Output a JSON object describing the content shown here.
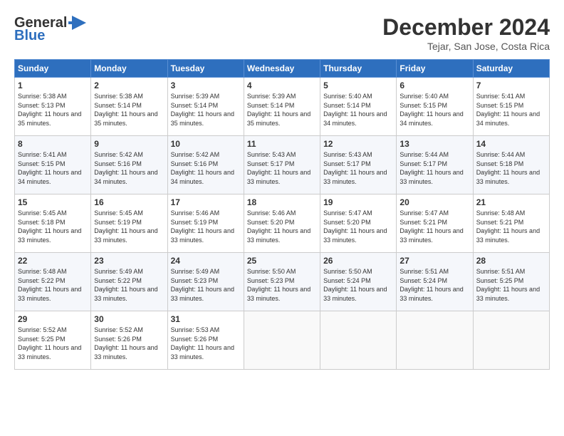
{
  "header": {
    "logo_general": "General",
    "logo_blue": "Blue",
    "month_title": "December 2024",
    "subtitle": "Tejar, San Jose, Costa Rica"
  },
  "weekdays": [
    "Sunday",
    "Monday",
    "Tuesday",
    "Wednesday",
    "Thursday",
    "Friday",
    "Saturday"
  ],
  "weeks": [
    [
      {
        "day": "1",
        "sunrise": "Sunrise: 5:38 AM",
        "sunset": "Sunset: 5:13 PM",
        "daylight": "Daylight: 11 hours and 35 minutes."
      },
      {
        "day": "2",
        "sunrise": "Sunrise: 5:38 AM",
        "sunset": "Sunset: 5:14 PM",
        "daylight": "Daylight: 11 hours and 35 minutes."
      },
      {
        "day": "3",
        "sunrise": "Sunrise: 5:39 AM",
        "sunset": "Sunset: 5:14 PM",
        "daylight": "Daylight: 11 hours and 35 minutes."
      },
      {
        "day": "4",
        "sunrise": "Sunrise: 5:39 AM",
        "sunset": "Sunset: 5:14 PM",
        "daylight": "Daylight: 11 hours and 35 minutes."
      },
      {
        "day": "5",
        "sunrise": "Sunrise: 5:40 AM",
        "sunset": "Sunset: 5:14 PM",
        "daylight": "Daylight: 11 hours and 34 minutes."
      },
      {
        "day": "6",
        "sunrise": "Sunrise: 5:40 AM",
        "sunset": "Sunset: 5:15 PM",
        "daylight": "Daylight: 11 hours and 34 minutes."
      },
      {
        "day": "7",
        "sunrise": "Sunrise: 5:41 AM",
        "sunset": "Sunset: 5:15 PM",
        "daylight": "Daylight: 11 hours and 34 minutes."
      }
    ],
    [
      {
        "day": "8",
        "sunrise": "Sunrise: 5:41 AM",
        "sunset": "Sunset: 5:15 PM",
        "daylight": "Daylight: 11 hours and 34 minutes."
      },
      {
        "day": "9",
        "sunrise": "Sunrise: 5:42 AM",
        "sunset": "Sunset: 5:16 PM",
        "daylight": "Daylight: 11 hours and 34 minutes."
      },
      {
        "day": "10",
        "sunrise": "Sunrise: 5:42 AM",
        "sunset": "Sunset: 5:16 PM",
        "daylight": "Daylight: 11 hours and 34 minutes."
      },
      {
        "day": "11",
        "sunrise": "Sunrise: 5:43 AM",
        "sunset": "Sunset: 5:17 PM",
        "daylight": "Daylight: 11 hours and 33 minutes."
      },
      {
        "day": "12",
        "sunrise": "Sunrise: 5:43 AM",
        "sunset": "Sunset: 5:17 PM",
        "daylight": "Daylight: 11 hours and 33 minutes."
      },
      {
        "day": "13",
        "sunrise": "Sunrise: 5:44 AM",
        "sunset": "Sunset: 5:17 PM",
        "daylight": "Daylight: 11 hours and 33 minutes."
      },
      {
        "day": "14",
        "sunrise": "Sunrise: 5:44 AM",
        "sunset": "Sunset: 5:18 PM",
        "daylight": "Daylight: 11 hours and 33 minutes."
      }
    ],
    [
      {
        "day": "15",
        "sunrise": "Sunrise: 5:45 AM",
        "sunset": "Sunset: 5:18 PM",
        "daylight": "Daylight: 11 hours and 33 minutes."
      },
      {
        "day": "16",
        "sunrise": "Sunrise: 5:45 AM",
        "sunset": "Sunset: 5:19 PM",
        "daylight": "Daylight: 11 hours and 33 minutes."
      },
      {
        "day": "17",
        "sunrise": "Sunrise: 5:46 AM",
        "sunset": "Sunset: 5:19 PM",
        "daylight": "Daylight: 11 hours and 33 minutes."
      },
      {
        "day": "18",
        "sunrise": "Sunrise: 5:46 AM",
        "sunset": "Sunset: 5:20 PM",
        "daylight": "Daylight: 11 hours and 33 minutes."
      },
      {
        "day": "19",
        "sunrise": "Sunrise: 5:47 AM",
        "sunset": "Sunset: 5:20 PM",
        "daylight": "Daylight: 11 hours and 33 minutes."
      },
      {
        "day": "20",
        "sunrise": "Sunrise: 5:47 AM",
        "sunset": "Sunset: 5:21 PM",
        "daylight": "Daylight: 11 hours and 33 minutes."
      },
      {
        "day": "21",
        "sunrise": "Sunrise: 5:48 AM",
        "sunset": "Sunset: 5:21 PM",
        "daylight": "Daylight: 11 hours and 33 minutes."
      }
    ],
    [
      {
        "day": "22",
        "sunrise": "Sunrise: 5:48 AM",
        "sunset": "Sunset: 5:22 PM",
        "daylight": "Daylight: 11 hours and 33 minutes."
      },
      {
        "day": "23",
        "sunrise": "Sunrise: 5:49 AM",
        "sunset": "Sunset: 5:22 PM",
        "daylight": "Daylight: 11 hours and 33 minutes."
      },
      {
        "day": "24",
        "sunrise": "Sunrise: 5:49 AM",
        "sunset": "Sunset: 5:23 PM",
        "daylight": "Daylight: 11 hours and 33 minutes."
      },
      {
        "day": "25",
        "sunrise": "Sunrise: 5:50 AM",
        "sunset": "Sunset: 5:23 PM",
        "daylight": "Daylight: 11 hours and 33 minutes."
      },
      {
        "day": "26",
        "sunrise": "Sunrise: 5:50 AM",
        "sunset": "Sunset: 5:24 PM",
        "daylight": "Daylight: 11 hours and 33 minutes."
      },
      {
        "day": "27",
        "sunrise": "Sunrise: 5:51 AM",
        "sunset": "Sunset: 5:24 PM",
        "daylight": "Daylight: 11 hours and 33 minutes."
      },
      {
        "day": "28",
        "sunrise": "Sunrise: 5:51 AM",
        "sunset": "Sunset: 5:25 PM",
        "daylight": "Daylight: 11 hours and 33 minutes."
      }
    ],
    [
      {
        "day": "29",
        "sunrise": "Sunrise: 5:52 AM",
        "sunset": "Sunset: 5:25 PM",
        "daylight": "Daylight: 11 hours and 33 minutes."
      },
      {
        "day": "30",
        "sunrise": "Sunrise: 5:52 AM",
        "sunset": "Sunset: 5:26 PM",
        "daylight": "Daylight: 11 hours and 33 minutes."
      },
      {
        "day": "31",
        "sunrise": "Sunrise: 5:53 AM",
        "sunset": "Sunset: 5:26 PM",
        "daylight": "Daylight: 11 hours and 33 minutes."
      },
      null,
      null,
      null,
      null
    ]
  ]
}
